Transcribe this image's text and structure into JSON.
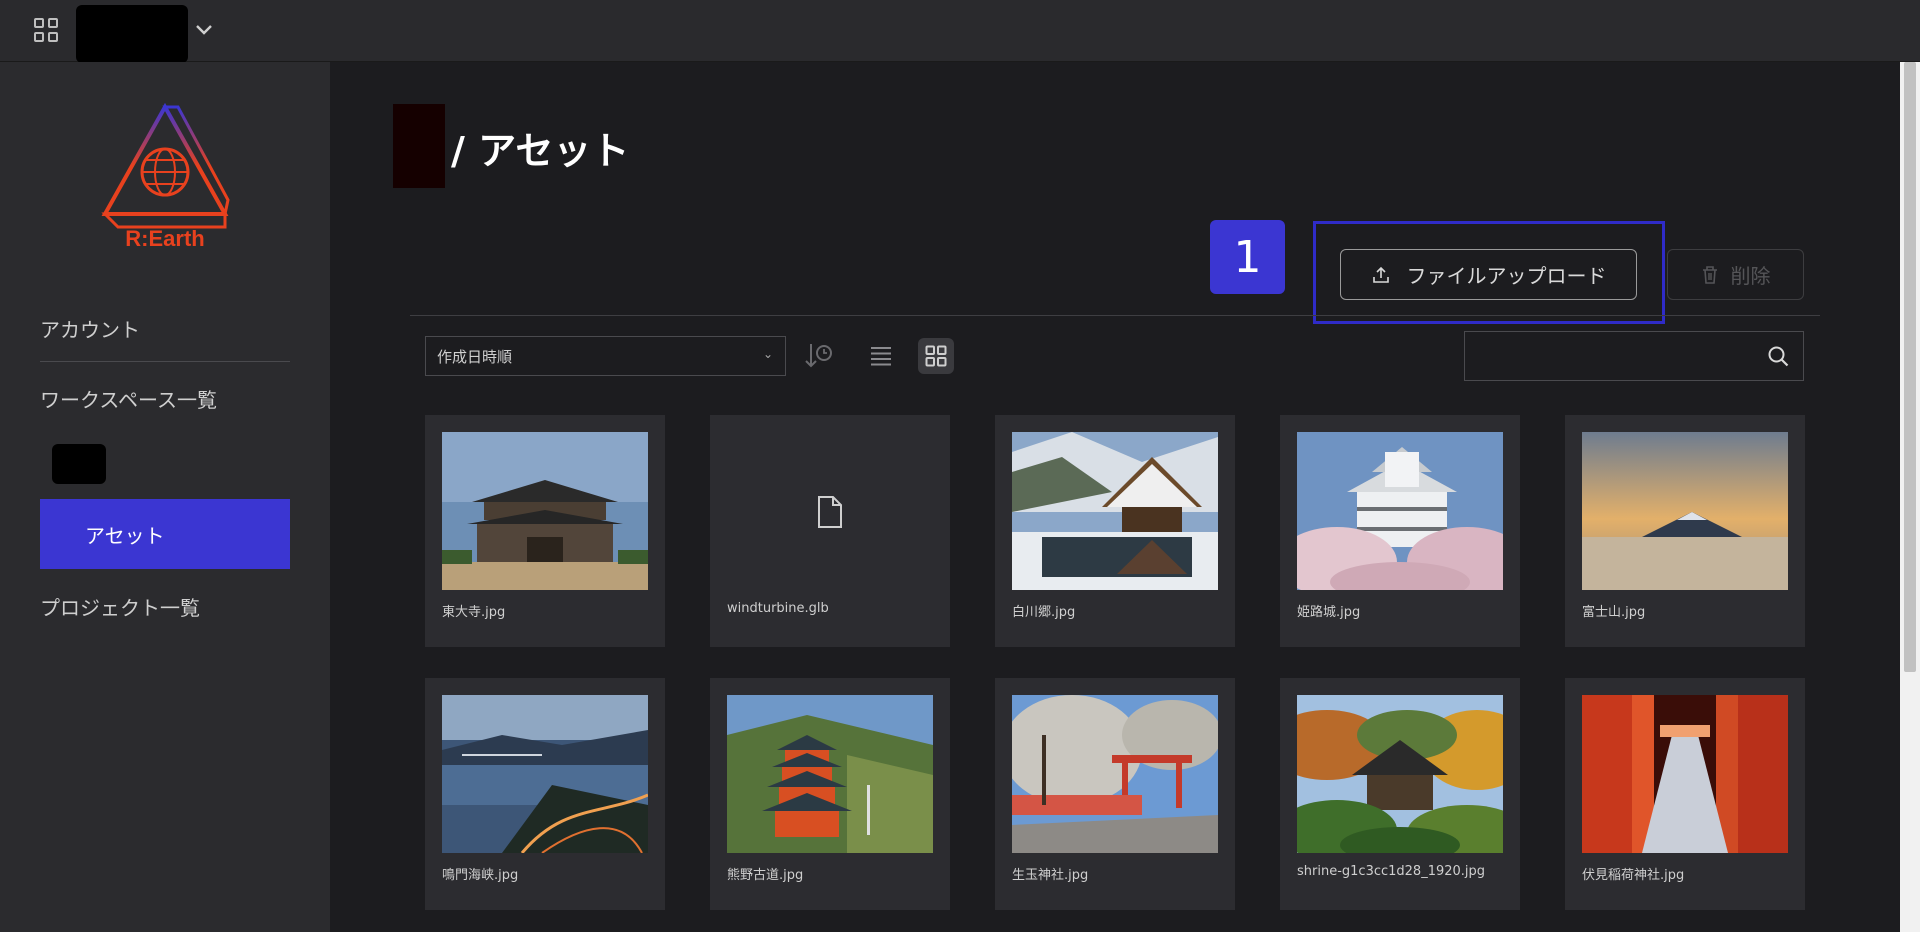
{
  "topbar": {
    "apps_icon": "grid-icon",
    "chevron_icon": "chevron-down-icon"
  },
  "sidebar": {
    "logo_text": "R:Earth",
    "items": [
      {
        "label": "アカウント"
      },
      {
        "label": "ワークスペース一覧"
      },
      {
        "label": "アセット",
        "active": true
      },
      {
        "label": "プロジェクト一覧"
      }
    ]
  },
  "main": {
    "title": "/ アセット",
    "step_badge": "1",
    "upload_label": "ファイルアップロード",
    "delete_label": "削除",
    "sort": {
      "selected": "作成日時順"
    },
    "search": {
      "placeholder": "",
      "value": ""
    }
  },
  "assets": [
    {
      "name": "東大寺.jpg"
    },
    {
      "name": "windturbine.glb"
    },
    {
      "name": "白川郷.jpg"
    },
    {
      "name": "姫路城.jpg"
    },
    {
      "name": "富士山.jpg"
    },
    {
      "name": "鳴門海峡.jpg"
    },
    {
      "name": "熊野古道.jpg"
    },
    {
      "name": "生玉神社.jpg"
    },
    {
      "name": "shrine-g1c3cc1d28_1920.jpg"
    },
    {
      "name": "伏見稲荷神社.jpg"
    }
  ],
  "colors": {
    "accent": "#3b36d2",
    "background": "#1c1c1f",
    "sidebar": "#2b2b2e",
    "card": "#2c2c30",
    "logo": "#e8411e"
  }
}
